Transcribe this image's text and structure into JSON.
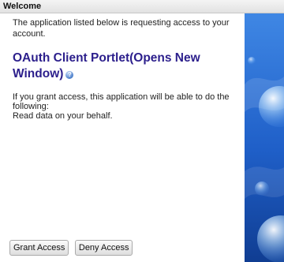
{
  "window": {
    "title": "Welcome"
  },
  "consent": {
    "intro": "The application listed below is requesting access to your account.",
    "app_name": "OAuth Client Portlet(Opens New Window)",
    "help_icon": "help-question-icon",
    "grant_line1": "If you grant access, this application will be able to do the following:",
    "grant_line2": "Read data on your behalf."
  },
  "buttons": {
    "grant_label": "Grant Access",
    "deny_label": "Deny Access"
  },
  "colors": {
    "app_name": "#2c1f8c",
    "wallpaper": "#1f5fc8"
  }
}
